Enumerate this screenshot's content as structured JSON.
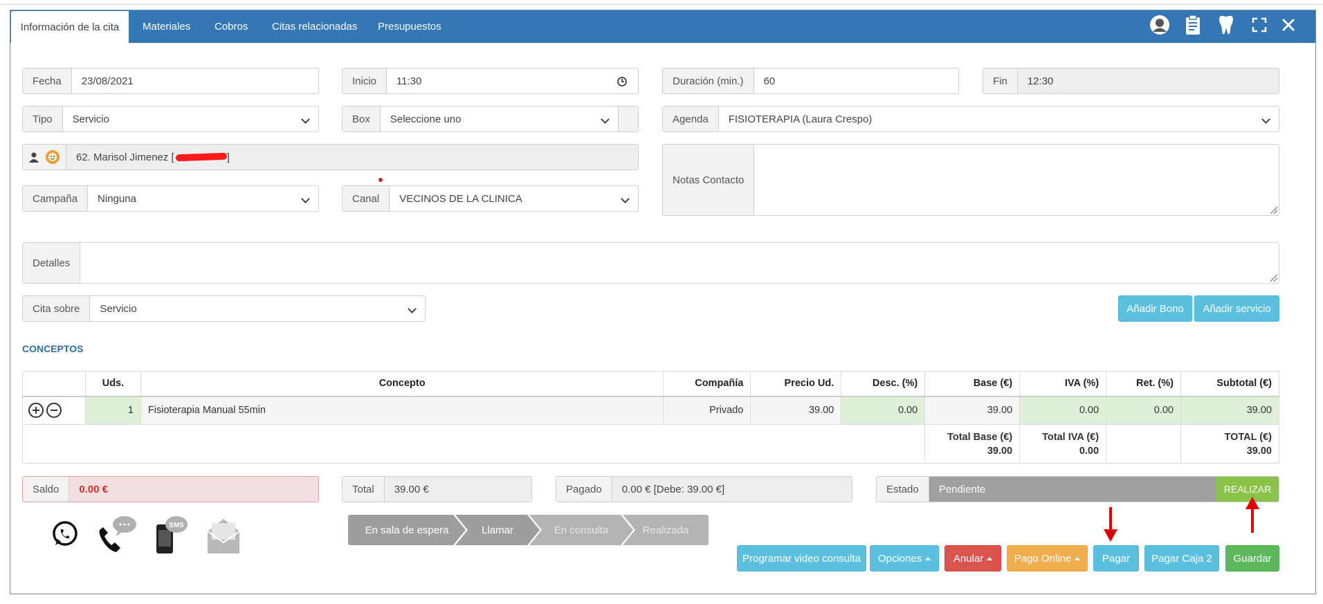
{
  "tabs": [
    "Información de la cita",
    "Materiales",
    "Cobros",
    "Citas relacionadas",
    "Presupuestos"
  ],
  "toolbar_icons": [
    "user-icon",
    "clipboard-icon",
    "tooth-icon",
    "expand-icon",
    "close-icon"
  ],
  "fields": {
    "fecha": {
      "label": "Fecha",
      "value": "23/08/2021"
    },
    "inicio": {
      "label": "Inicio",
      "value": "11:30"
    },
    "duracion": {
      "label": "Duración (min.)",
      "value": "60"
    },
    "fin": {
      "label": "Fin",
      "value": "12:30"
    },
    "tipo": {
      "label": "Tipo",
      "value": "Servicio"
    },
    "box": {
      "label": "Box",
      "value": "Seleccione uno"
    },
    "agenda": {
      "label": "Agenda",
      "value": "FISIOTERAPIA (Laura Crespo)"
    },
    "paciente": {
      "value": "62. Marisol Jimenez ["
    },
    "notas": {
      "label": "Notas Contacto",
      "value": ""
    },
    "campana": {
      "label": "Campaña",
      "value": "Ninguna"
    },
    "canal": {
      "label": "Canal",
      "value": "VECINOS DE LA CLINICA"
    },
    "detalles": {
      "label": "Detalles",
      "value": ""
    },
    "cita_sobre": {
      "label": "Cita sobre",
      "value": "Servicio"
    }
  },
  "buttons": {
    "anadir_bono": "Añadir Bono",
    "anadir_servicio": "Añadir servicio",
    "realizar": "REALIZAR",
    "programar": "Programar video consulta",
    "opciones": "Opciones",
    "anular": "Anular",
    "pago_online": "Pago Online",
    "pagar": "Pagar",
    "pagar_caja2": "Pagar Caja 2",
    "guardar": "Guardar"
  },
  "conceptos": {
    "title": "CONCEPTOS",
    "headers": [
      "",
      "Uds.",
      "Concepto",
      "Compañía",
      "Precio Ud.",
      "Desc. (%)",
      "Base (€)",
      "IVA (%)",
      "Ret. (%)",
      "Subtotal (€)"
    ],
    "row": {
      "uds": "1",
      "concepto": "Fisioterapia Manual 55min",
      "compania": "Privado",
      "precio": "39.00",
      "desc": "0.00",
      "base": "39.00",
      "iva": "0.00",
      "ret": "0.00",
      "subtotal": "39.00"
    },
    "totals": {
      "base_label": "Total Base (€)",
      "base": "39.00",
      "iva_label": "Total IVA (€)",
      "iva": "0.00",
      "total_label": "TOTAL (€)",
      "total": "39.00"
    }
  },
  "summary": {
    "saldo": {
      "label": "Saldo",
      "value": "0.00 €"
    },
    "total": {
      "label": "Total",
      "value": "39.00 €"
    },
    "pagado": {
      "label": "Pagado",
      "value": "0.00 € [Debe: 39.00 €]"
    },
    "estado": {
      "label": "Estado",
      "value": "Pendiente"
    }
  },
  "contact_icons": [
    "whatsapp-icon",
    "phone-chat-icon",
    "sms-icon",
    "email-icon"
  ],
  "steps": [
    "En sala de espera",
    "Llamar",
    "En consulta",
    "Realizada"
  ],
  "colors": {
    "header": "#3477b4",
    "info": "#5bc0de",
    "danger": "#d9534f",
    "warning": "#f0ad4e",
    "success": "#5cb85c",
    "realizar": "#8bc34a",
    "section_title": "#2e6da4"
  }
}
